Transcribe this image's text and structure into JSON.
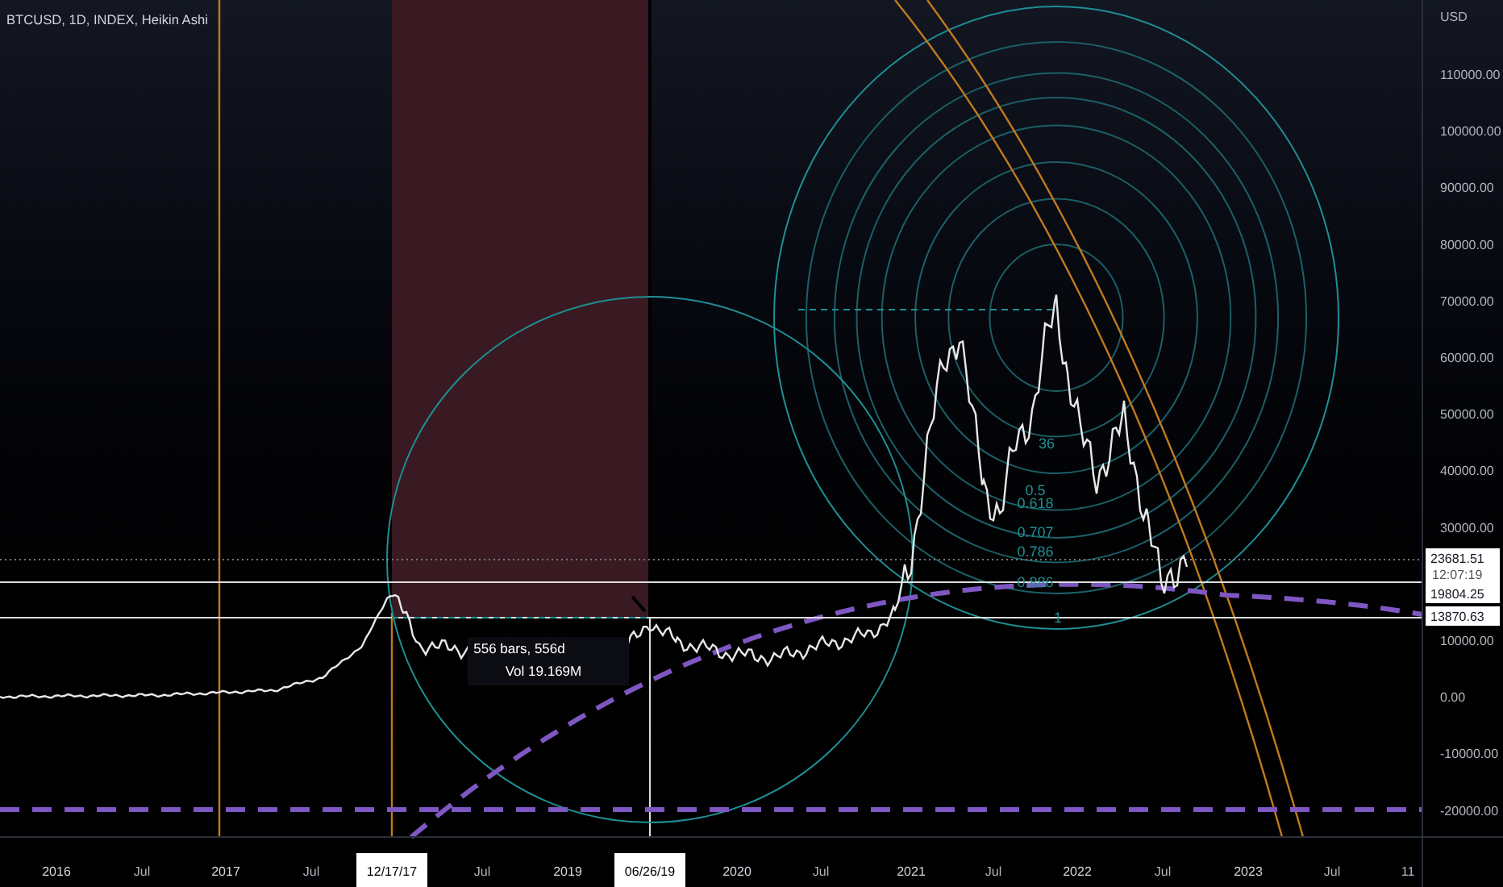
{
  "chart": {
    "title": "BTCUSD, 1D, INDEX, Heikin Ashi",
    "currency": "USD",
    "y_ticks": [
      "110000.00",
      "100000.00",
      "90000.00",
      "80000.00",
      "70000.00",
      "60000.00",
      "50000.00",
      "40000.00",
      "30000.00",
      "10000.00",
      "0.00",
      "-10000.00",
      "-20000.00"
    ],
    "x_ticks": [
      {
        "label": "2016",
        "kind": "year"
      },
      {
        "label": "Jul",
        "kind": "month"
      },
      {
        "label": "2017",
        "kind": "year"
      },
      {
        "label": "Jul",
        "kind": "month"
      },
      {
        "label": "12/17/17",
        "kind": "marker"
      },
      {
        "label": "Jul",
        "kind": "month"
      },
      {
        "label": "2019",
        "kind": "year"
      },
      {
        "label": "06/26/19",
        "kind": "marker"
      },
      {
        "label": "2020",
        "kind": "year"
      },
      {
        "label": "Jul",
        "kind": "month"
      },
      {
        "label": "2021",
        "kind": "year"
      },
      {
        "label": "Jul",
        "kind": "month"
      },
      {
        "label": "2022",
        "kind": "year"
      },
      {
        "label": "Jul",
        "kind": "month"
      },
      {
        "label": "2023",
        "kind": "year"
      },
      {
        "label": "Jul",
        "kind": "month"
      },
      {
        "label": "11",
        "kind": "month"
      }
    ],
    "price_labels": [
      {
        "text": "23681.51",
        "countdown": "12:07:19",
        "kind": "last"
      },
      {
        "text": "19804.25",
        "kind": "line"
      },
      {
        "text": "13870.63",
        "kind": "line"
      }
    ],
    "measure": {
      "bars": "556 bars, 556d",
      "volume": "Vol 19.169M"
    },
    "fib_levels": [
      "36",
      "0.5",
      "0.618",
      "0.707",
      "0.786",
      "0.886",
      "1"
    ]
  }
}
